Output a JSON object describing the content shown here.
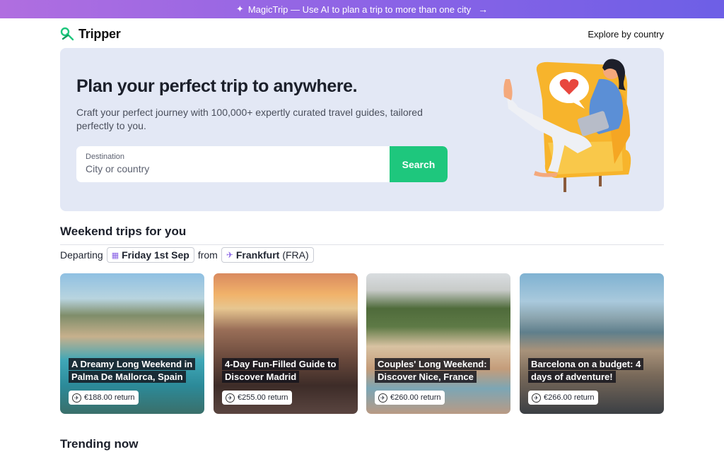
{
  "banner": {
    "text": "MagicTrip — Use AI to plan a trip to more than one city"
  },
  "nav": {
    "brand": "Tripper",
    "explore_link": "Explore by country"
  },
  "hero": {
    "title": "Plan your perfect trip to anywhere.",
    "subtitle": "Craft your perfect journey with 100,000+ expertly curated travel guides, tailored perfectly to you.",
    "search": {
      "label": "Destination",
      "placeholder": "City or country",
      "button": "Search"
    }
  },
  "weekend": {
    "title": "Weekend trips for you",
    "departing_label": "Departing",
    "date": "Friday 1st Sep",
    "from_label": "from",
    "city": "Frankfurt",
    "code": "(FRA)",
    "cards": [
      {
        "title": "A Dreamy Long Weekend in Palma De Mallorca, Spain",
        "price": "€188.00 return"
      },
      {
        "title": "4-Day Fun-Filled Guide to Discover Madrid",
        "price": "€255.00 return"
      },
      {
        "title": "Couples' Long Weekend: Discover Nice, France",
        "price": "€260.00 return"
      },
      {
        "title": "Barcelona on a budget: 4 days of adventure!",
        "price": "€266.00 return"
      }
    ]
  },
  "trending": {
    "title": "Trending now"
  },
  "colors": {
    "accent": "#1ec77d",
    "banner_start": "#b06ee0",
    "banner_end": "#6d5fe6",
    "hero_bg": "#e3e8f5"
  }
}
